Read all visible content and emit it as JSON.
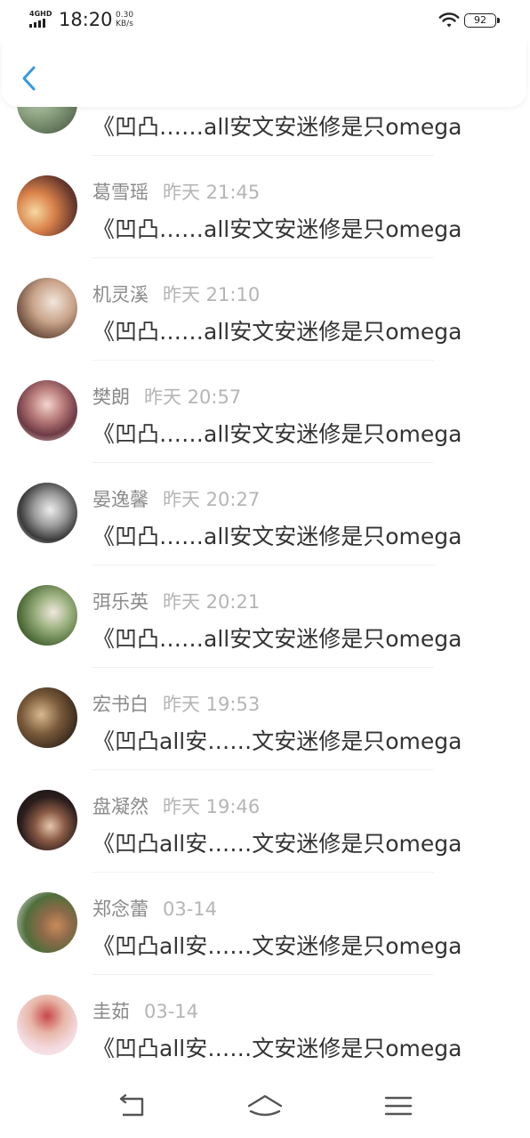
{
  "status_bar": {
    "network": "4GHD",
    "time": "18:20",
    "speed_value": "0.30",
    "speed_unit": "KB/s",
    "battery": "92"
  },
  "header": {
    "back_icon": "chevron-left-icon",
    "accent_color": "#2f9be0"
  },
  "list": {
    "items": [
      {
        "name": "",
        "time": "",
        "message": "《凹凸……all安文安迷修是只omega",
        "avatar": "photo"
      },
      {
        "name": "葛雪瑶",
        "time": "昨天 21:45",
        "message": "《凹凸……all安文安迷修是只omega",
        "avatar": "photo"
      },
      {
        "name": "机灵溪",
        "time": "昨天 21:10",
        "message": "《凹凸……all安文安迷修是只omega",
        "avatar": "photo"
      },
      {
        "name": "樊朗",
        "time": "昨天 20:57",
        "message": "《凹凸……all安文安迷修是只omega",
        "avatar": "photo"
      },
      {
        "name": "晏逸馨",
        "time": "昨天 20:27",
        "message": "《凹凸……all安文安迷修是只omega",
        "avatar": "photo"
      },
      {
        "name": "弭乐英",
        "time": "昨天 20:21",
        "message": "《凹凸……all安文安迷修是只omega",
        "avatar": "photo"
      },
      {
        "name": "宏书白",
        "time": "昨天 19:53",
        "message": "《凹凸all安……文安迷修是只omega",
        "avatar": "photo"
      },
      {
        "name": "盘凝然",
        "time": "昨天 19:46",
        "message": "《凹凸all安……文安迷修是只omega",
        "avatar": "photo"
      },
      {
        "name": "郑念蕾",
        "time": "03-14",
        "message": "《凹凸all安……文安迷修是只omega",
        "avatar": "photo"
      },
      {
        "name": "圭茹",
        "time": "03-14",
        "message": "《凹凸all安……文安迷修是只omega",
        "avatar": "photo"
      }
    ]
  },
  "nav_bar": {
    "back_icon": "back-arrow-icon",
    "home_icon": "home-icon",
    "menu_icon": "menu-icon"
  }
}
